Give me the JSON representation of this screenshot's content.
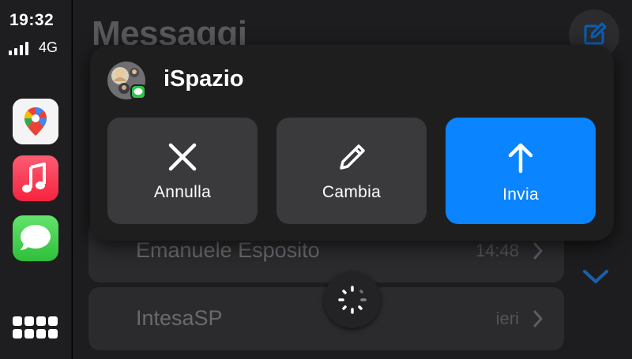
{
  "status": {
    "time": "19:32",
    "network": "4G",
    "signal_bars": 4
  },
  "sidebar": {
    "apps": [
      {
        "name": "Maps",
        "icon": "maps-icon"
      },
      {
        "name": "Music",
        "icon": "music-icon"
      },
      {
        "name": "Messages",
        "icon": "messages-icon"
      }
    ],
    "dashboard_icon": "grid-icon"
  },
  "background": {
    "title": "Messaggi",
    "conversations": [
      {
        "name": "Emanuele Esposito",
        "time": "14:48"
      },
      {
        "name": "IntesaSP",
        "time": "ieri"
      }
    ]
  },
  "dialog": {
    "contact": "iSpazio",
    "actions": {
      "cancel": {
        "label": "Annulla",
        "icon": "close-icon"
      },
      "edit": {
        "label": "Cambia",
        "icon": "pencil-icon"
      },
      "send": {
        "label": "Invia",
        "icon": "arrow-up-icon"
      }
    }
  },
  "colors": {
    "accent": "#0a84ff",
    "button": "#3a3a3c",
    "dialog": "#1e1e1f",
    "sidebar": "#1e1e20"
  }
}
